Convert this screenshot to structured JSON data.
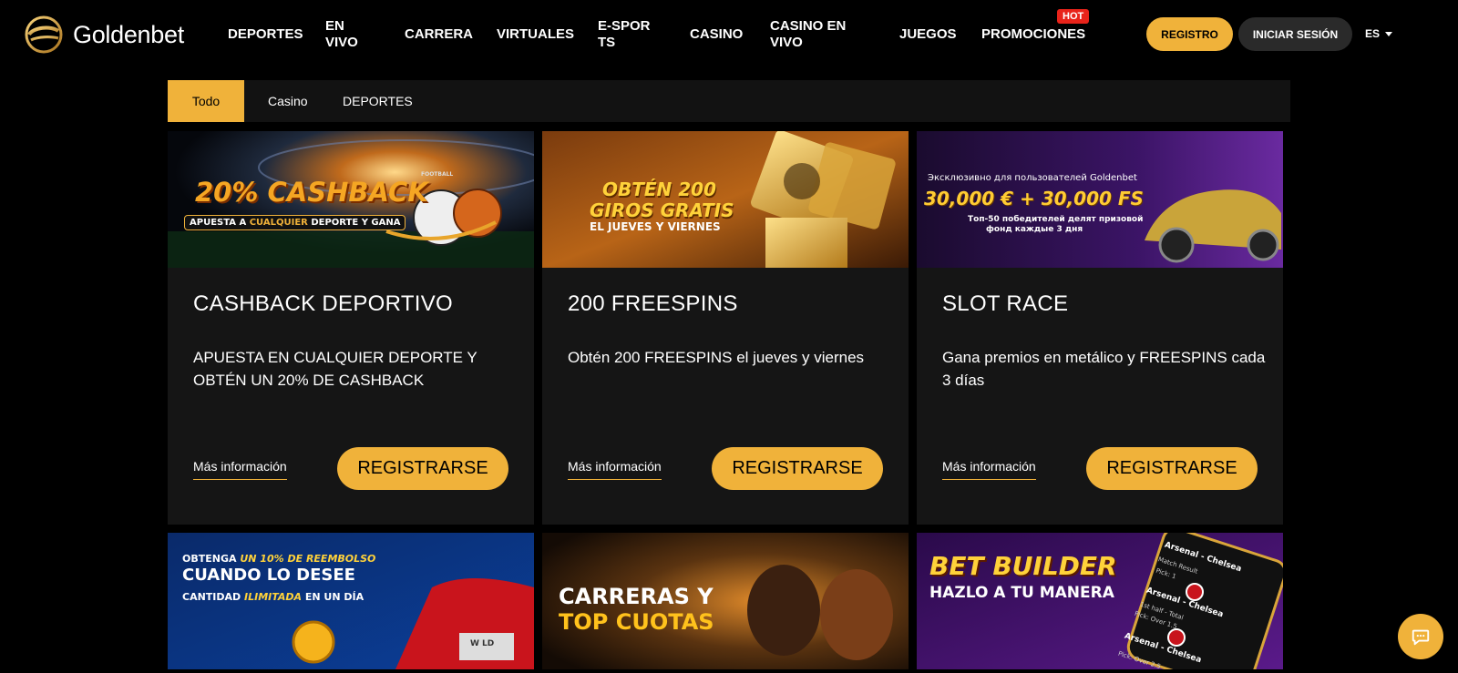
{
  "header": {
    "brand": "Goldenbet",
    "nav": [
      {
        "label": "DEPORTES"
      },
      {
        "label": "EN VIVO"
      },
      {
        "label": "CARRERA"
      },
      {
        "label": "VIRTUALES"
      },
      {
        "label": "E-SPORTS"
      },
      {
        "label": "CASINO"
      },
      {
        "label": "CASINO EN VIVO"
      },
      {
        "label": "JUEGOS"
      },
      {
        "label": "PROMOCIONES"
      }
    ],
    "hot_badge": "HOT",
    "register_label": "REGISTRO",
    "login_label": "INICIAR SESIÓN",
    "language": "ES"
  },
  "tabs": [
    {
      "label": "Todo",
      "active": true
    },
    {
      "label": "Casino",
      "active": false
    },
    {
      "label": "DEPORTES",
      "active": false
    }
  ],
  "cards": [
    {
      "banner": {
        "line1": "20% CASHBACK",
        "line2_a": "APUESTA A ",
        "line2_b": "CUALQUIER",
        "line2_c": " DEPORTE Y GANA",
        "tag": "FOOTBALL"
      },
      "title": "CASHBACK DEPORTIVO",
      "description": "APUESTA EN CUALQUIER DEPORTE Y OBTÉN UN 20% DE CASHBACK",
      "more_label": "Más información",
      "button_label": "REGISTRARSE"
    },
    {
      "banner": {
        "line1": "OBTÉN 200",
        "line2": "GIROS GRATIS",
        "line3": "EL JUEVES Y VIERNES"
      },
      "title": "200 FREESPINS",
      "description": "Obtén 200 FREESPINS el jueves y viernes",
      "more_label": "Más información",
      "button_label": "REGISTRARSE"
    },
    {
      "banner": {
        "line1": "Эксклюзивно для пользователей Goldenbet",
        "line2": "30,000 € + 30,000 FS",
        "line3": "Топ-50 победителей делят призовой",
        "line4": "фонд каждые 3 дня"
      },
      "title": "SLOT RACE",
      "description": "Gana premios en metálico y FREESPINS cada 3 días",
      "more_label": "Más información",
      "button_label": "REGISTRARSE"
    }
  ],
  "bottom_banners": [
    {
      "line1_a": "OBTENGA ",
      "line1_b": "UN 10% DE REEMBOLSO",
      "line2": "CUANDO LO DESEE",
      "line3_a": "CANTIDAD ",
      "line3_b": "ILIMITADA",
      "line3_c": " EN UN DÍA",
      "plate": "W   LD"
    },
    {
      "line1": "CARRERAS Y",
      "line2": "TOP CUOTAS"
    },
    {
      "line1": "BET BUILDER",
      "line2": "HAZLO A TU MANERA",
      "match": "Arsenal - Chelsea",
      "sub1": "Match Result",
      "pick1": "Pick: 1",
      "sub2": "1st half - Total",
      "pick2": "Pick: Over 1.5",
      "pick3": "Pick: Over 2.5"
    }
  ],
  "colors": {
    "accent": "#f0b23a",
    "hot": "#e8231a",
    "card_bg": "#151515"
  }
}
